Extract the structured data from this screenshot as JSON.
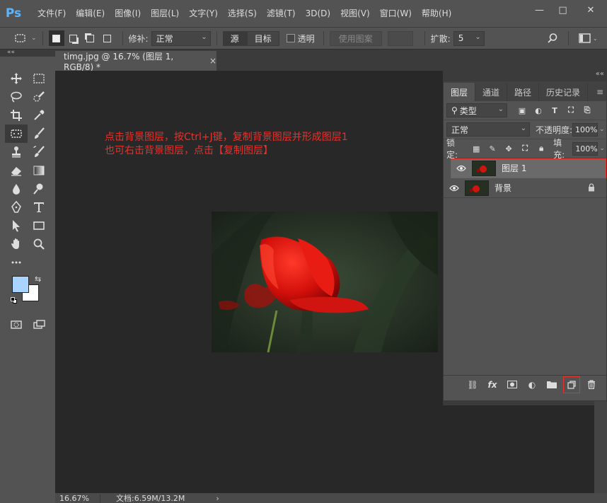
{
  "app": {
    "logo": "Ps"
  },
  "menu": [
    "文件(F)",
    "编辑(E)",
    "图像(I)",
    "图层(L)",
    "文字(Y)",
    "选择(S)",
    "滤镜(T)",
    "3D(D)",
    "视图(V)",
    "窗口(W)",
    "帮助(H)"
  ],
  "window_controls": {
    "minimize": "—",
    "maximize": "□",
    "close": "✕"
  },
  "options": {
    "repair_label": "修补:",
    "repair_mode": "正常",
    "source_label": "源",
    "target_label": "目标",
    "transparent_label": "透明",
    "use_pattern_label": "使用图案",
    "diffusion_label": "扩散:",
    "diffusion_value": "5"
  },
  "document": {
    "tab_title": "timg.jpg @ 16.7% (图层 1, RGB/8) *",
    "tab_close": "×",
    "annotation_line1": "点击背景图层，按Ctrl+J键，复制背景图层并形成图层1",
    "annotation_line2": "也可右击背景图层，点击【复制图层】"
  },
  "status": {
    "zoom": "16.67%",
    "doc_size": "文档:6.59M/13.2M",
    "arrow": "›"
  },
  "layers_panel": {
    "tabs": [
      "图层",
      "通道",
      "路径",
      "历史记录"
    ],
    "filter_kind": "类型",
    "blend_mode": "正常",
    "opacity_label": "不透明度:",
    "opacity_value": "100%",
    "lock_label": "锁定:",
    "fill_label": "填充:",
    "fill_value": "100%",
    "layers": [
      {
        "name": "图层 1",
        "selected": true,
        "locked": false
      },
      {
        "name": "背景",
        "selected": false,
        "locked": true
      }
    ]
  },
  "colors": {
    "accent_red": "#e8312b",
    "foreground": "#a8d4ff",
    "background": "#ffffff",
    "ps_blue": "#5ab5ff"
  }
}
